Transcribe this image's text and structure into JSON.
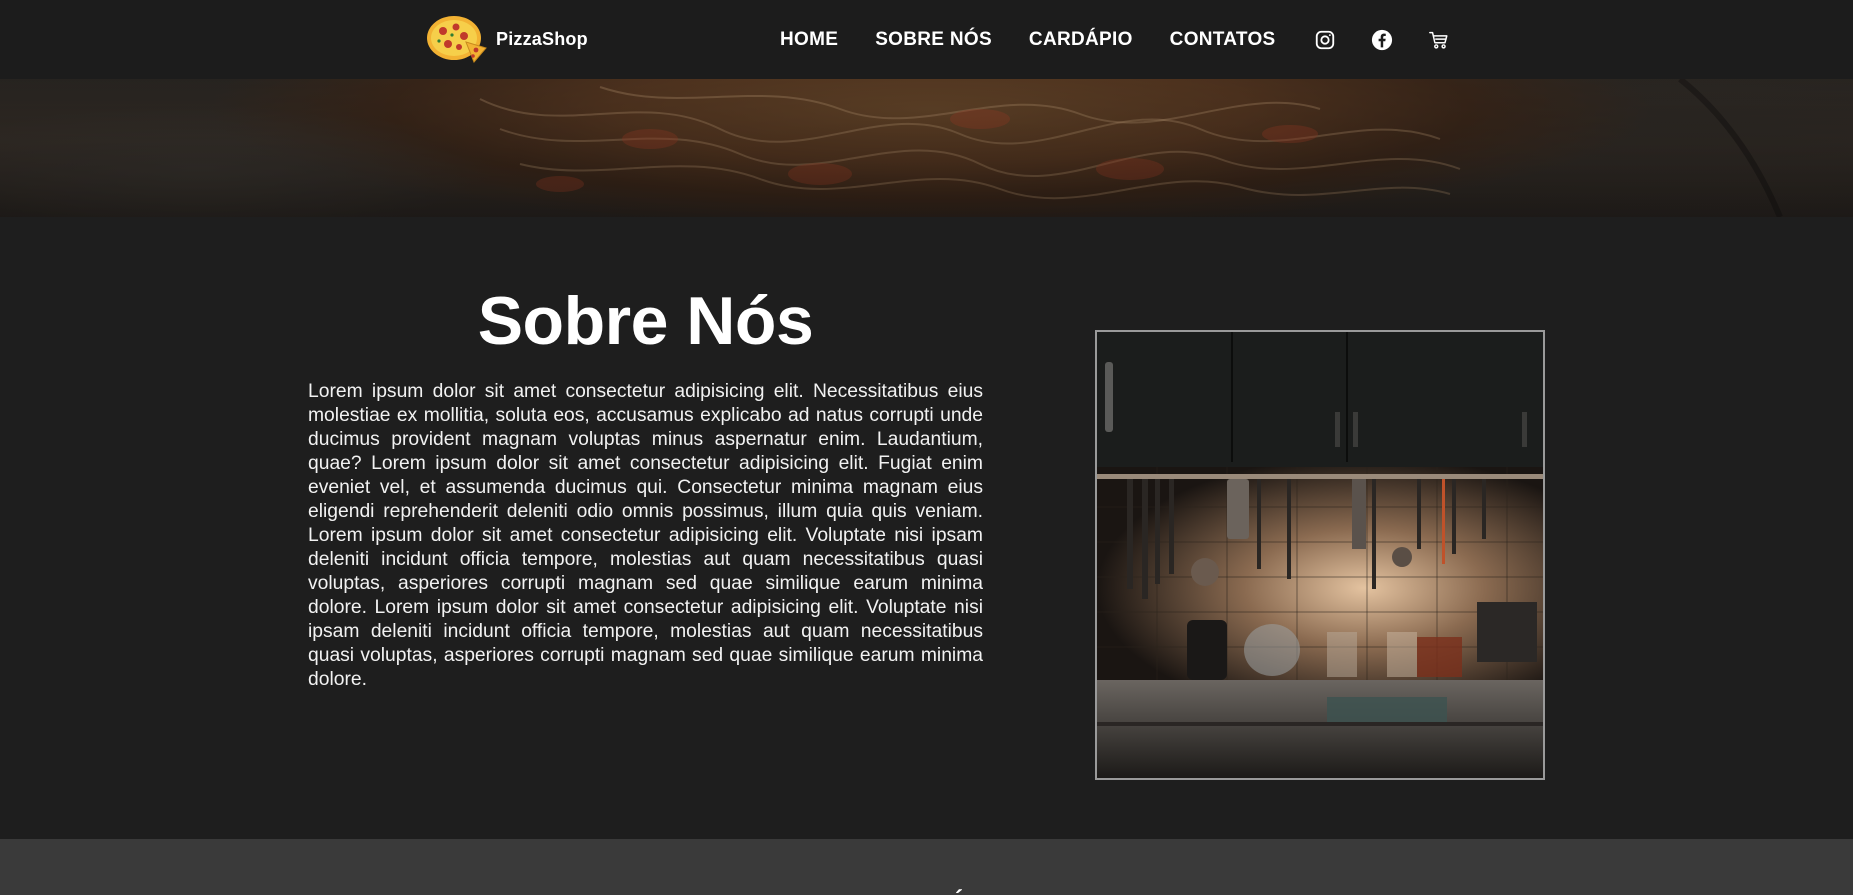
{
  "header": {
    "brand_name": "PizzaShop",
    "nav": [
      {
        "label": "HOME"
      },
      {
        "label": "SOBRE NÓS"
      },
      {
        "label": "CARDÁPIO"
      },
      {
        "label": "CONTATOS"
      }
    ],
    "icons": [
      "instagram-icon",
      "facebook-icon",
      "cart-icon"
    ]
  },
  "about": {
    "title": "Sobre Nós",
    "text": "Lorem ipsum dolor sit amet consectetur adipisicing elit. Necessitatibus eius molestiae ex mollitia, soluta eos, accusamus explicabo ad natus corrupti unde ducimus provident magnam voluptas minus aspernatur enim. Laudantium, quae? Lorem ipsum dolor sit amet consectetur adipisicing elit. Fugiat enim eveniet vel, et assumenda ducimus qui. Consectetur minima magnam eius eligendi reprehenderit deleniti odio omnis possimus, illum quia quis veniam. Lorem ipsum dolor sit amet consectetur adipisicing elit. Voluptate nisi ipsam deleniti incidunt officia tempore, molestias aut quam necessitatibus quasi voluptas, asperiores corrupti magnam sed quae similique earum minima dolore. Lorem ipsum dolor sit amet consectetur adipisicing elit. Voluptate nisi ipsam deleniti incidunt officia tempore, molestias aut quam necessitatibus quasi voluptas, asperiores corrupti magnam sed quae similique earum minima dolore."
  },
  "colors": {
    "header_bg": "#1c1c1c",
    "page_bg": "#1e1e1e",
    "next_section_bg": "#3a3a3a",
    "image_border": "#9a9a9a",
    "text": "#ffffff"
  }
}
